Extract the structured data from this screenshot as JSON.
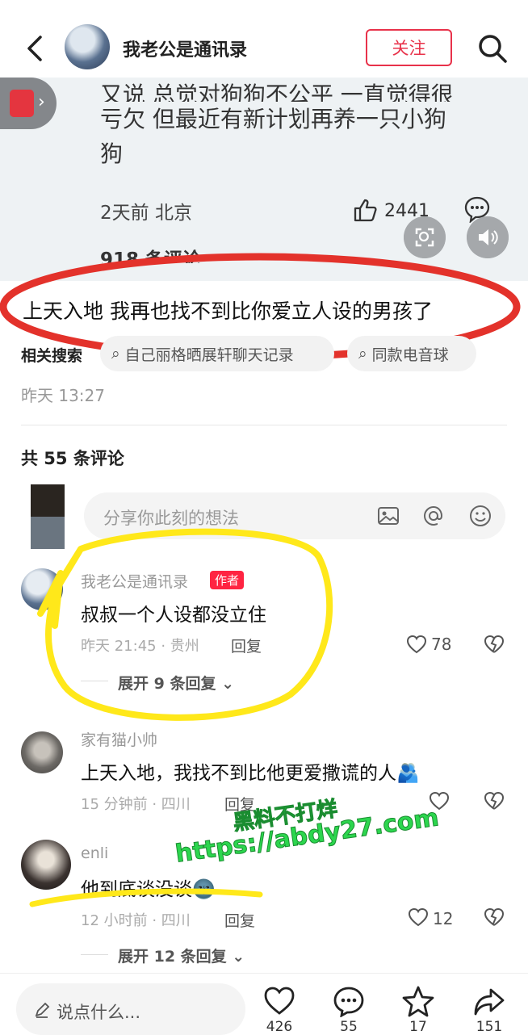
{
  "header": {
    "title": "我老公是通讯录",
    "follow_label": "关注"
  },
  "post": {
    "text_cut": "又说 总觉对狗狗不公平 一直觉得很",
    "text_line2": "亏欠 但最近有新计划再养一只小狗",
    "text_line3": "狗",
    "meta": "2天前 北京",
    "likes": "2441",
    "comment_count": "918 条评论"
  },
  "caption": "上天入地 我再也找不到比你爱立人设的男孩了",
  "related": {
    "label": "相关搜索",
    "chips": [
      "自己丽格晒展轩聊天记录",
      "同款电音球"
    ]
  },
  "post_date": "昨天 13:27",
  "comments_header": "共 55 条评论",
  "comment_input": {
    "placeholder": "分享你此刻的想法"
  },
  "comments": [
    {
      "name": "我老公是通讯录",
      "tag": "作者",
      "text": "叔叔一个人设都没立住",
      "meta": "昨天 21:45 · 贵州",
      "reply": "回复",
      "likes": "78",
      "expand": "展开 9 条回复"
    },
    {
      "name": "家有猫小帅",
      "text": "上天入地，我找不到比他更爱撒谎的人🫂",
      "meta": "15 分钟前 · 四川",
      "reply": "回复",
      "likes": ""
    },
    {
      "name": "enli",
      "text": "他到底谈没谈🌚",
      "meta": "12 小时前 · 四川",
      "reply": "回复",
      "likes": "12",
      "expand": "展开 12 条回复"
    }
  ],
  "watermark": {
    "line1": "黑料不打烊",
    "line2": "https://abdy27.com"
  },
  "bottom_bar": {
    "say_placeholder": "说点什么...",
    "likes": "426",
    "comments": "55",
    "stars": "17",
    "shares": "151"
  },
  "colors": {
    "accent": "#ff2442",
    "follow": "#e8324a",
    "annotation_red": "#e3322b",
    "annotation_yellow": "#ffe81a",
    "watermark": "#2cd64e"
  }
}
